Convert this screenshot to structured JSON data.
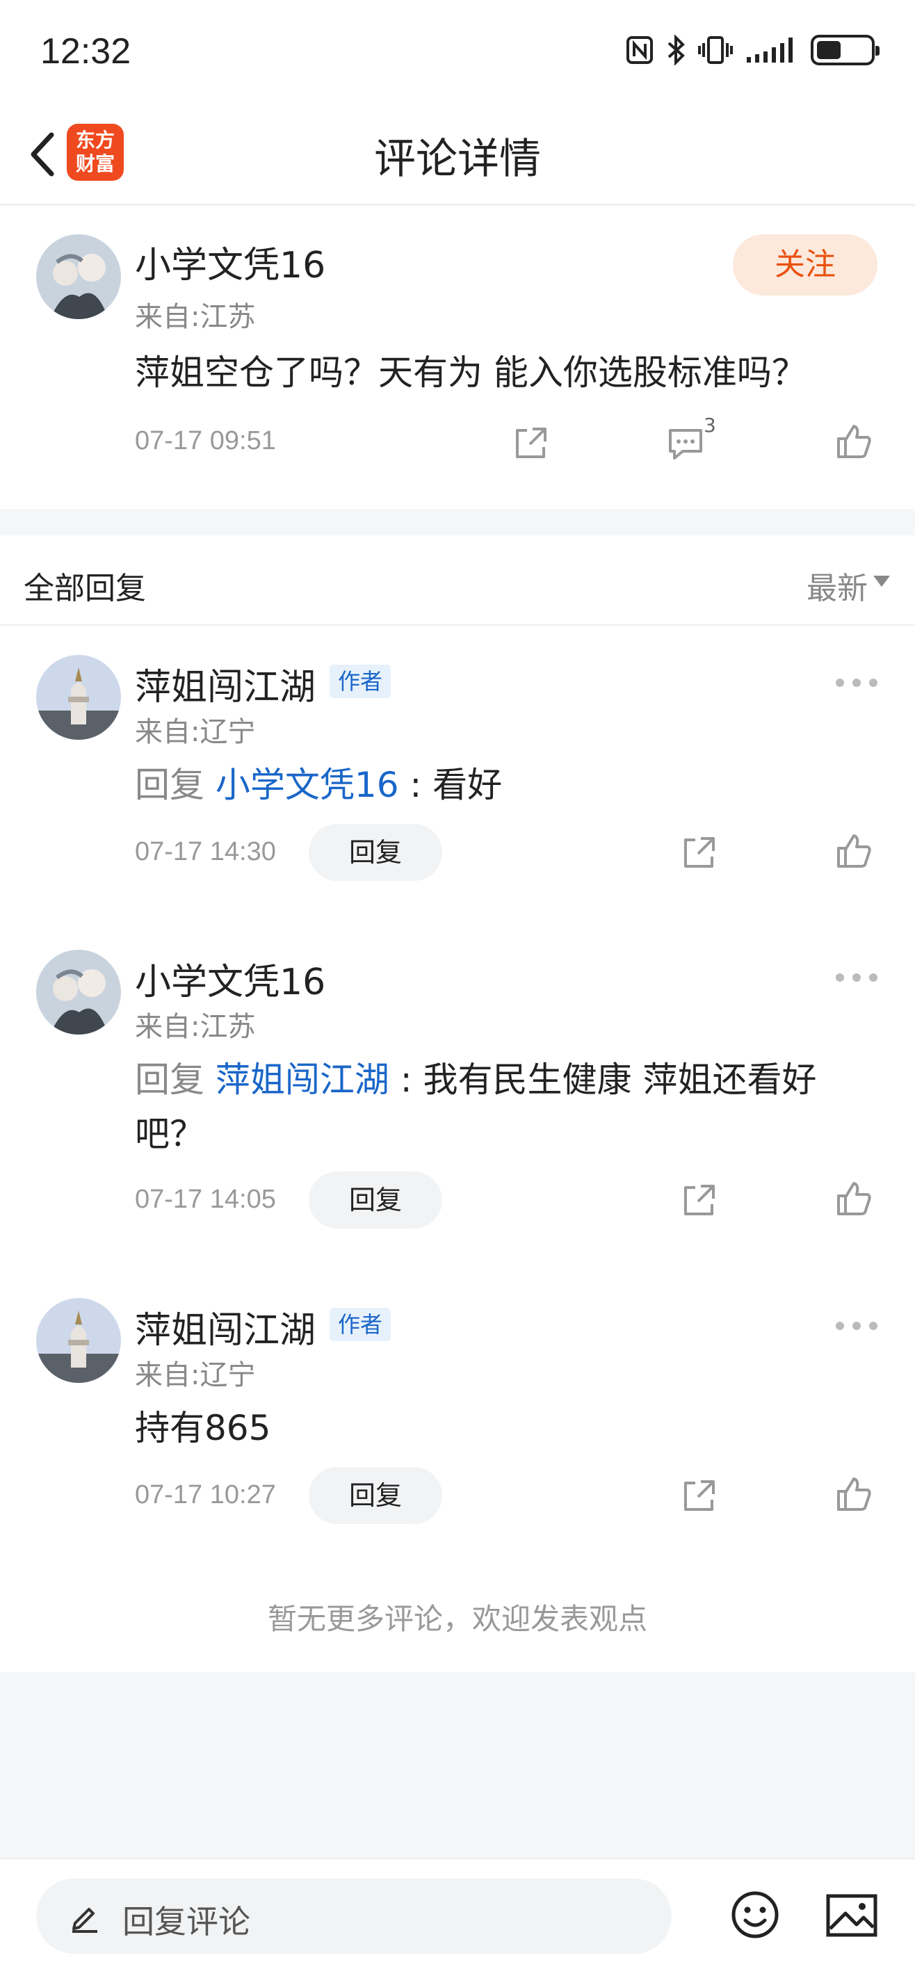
{
  "status_bar": {
    "time": "12:32",
    "icons": [
      "nfc-icon",
      "bluetooth-icon",
      "vibrate-icon",
      "signal-icon",
      "battery-icon"
    ]
  },
  "header": {
    "title": "评论详情",
    "logo_text_line1": "东方",
    "logo_text_line2": "财富"
  },
  "post": {
    "username": "小学文凭16",
    "location": "来自:江苏",
    "follow_label": "关注",
    "content": "萍姐空仓了吗？天有为 能入你选股标准吗？",
    "timestamp": "07-17 09:51",
    "comment_count": "3"
  },
  "replies_section": {
    "title": "全部回复",
    "sort_label": "最新"
  },
  "replies": [
    {
      "username": "萍姐闯江湖",
      "is_author": true,
      "author_badge": "作者",
      "location": "来自:辽宁",
      "reply_prefix": "回复 ",
      "reply_target": "小学文凭16",
      "reply_sep": " : ",
      "text": "看好",
      "timestamp": "07-17 14:30",
      "reply_label": "回复"
    },
    {
      "username": "小学文凭16",
      "is_author": false,
      "location": "来自:江苏",
      "reply_prefix": "回复 ",
      "reply_target": "萍姐闯江湖",
      "reply_sep": " : ",
      "text": "我有民生健康 萍姐还看好吧？",
      "timestamp": "07-17 14:05",
      "reply_label": "回复"
    },
    {
      "username": "萍姐闯江湖",
      "is_author": true,
      "author_badge": "作者",
      "location": "来自:辽宁",
      "text": "持有865",
      "timestamp": "07-17 10:27",
      "reply_label": "回复"
    }
  ],
  "footer_note": "暂无更多评论，欢迎发表观点",
  "bottom_bar": {
    "input_placeholder": "回复评论"
  },
  "colors": {
    "brand_orange": "#ef4a1f",
    "follow_text": "#e8520f",
    "follow_bg": "#fde8dc",
    "link_blue": "#1a66c9"
  }
}
